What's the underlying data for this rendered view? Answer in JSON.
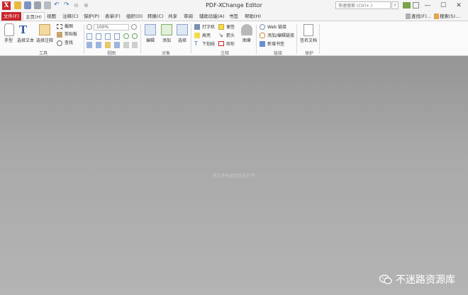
{
  "window": {
    "title": "PDF-XChange Editor",
    "logo_letter": "X"
  },
  "titlebar": {
    "search_placeholder": "快速搜索 (Ctrl+.)",
    "search_button": "›",
    "minimize": "—",
    "maximize": "☐",
    "close": "✕"
  },
  "menu": {
    "file": "文件(F)",
    "tabs": [
      "主页(H)",
      "视图",
      "注释(C)",
      "保护(P)",
      "表单(F)",
      "组织(O)",
      "转换(C)",
      "共享",
      "审阅",
      "辅助功能(A)",
      "书签",
      "帮助(H)"
    ],
    "find": "查找(F)...",
    "search": "搜索(S)..."
  },
  "ribbon": {
    "groups": [
      "工具",
      "视图",
      "对象",
      "注释",
      "链接",
      "保护"
    ],
    "tools": {
      "hand": "手型",
      "select_text": "选择文本",
      "select_annot": "选择注释",
      "snapshot": "截图",
      "clipboard": "剪贴板",
      "find": "查找"
    },
    "view": {
      "zoom": "100%"
    },
    "objects": {
      "edit": "编辑",
      "add": "添加",
      "select": "选择"
    },
    "comments": {
      "typewriter": "打字机",
      "highlight": "高亮",
      "underline": "下划线",
      "sticky_note": "便签",
      "arrow": "箭头",
      "rectangle": "矩形",
      "stamp": "图章"
    },
    "links": {
      "web_links": "Web 链接",
      "add_edit_link": "添加/编辑链接",
      "new_bookmark": "新增书签"
    },
    "protect": {
      "sign_document": "签名文档"
    }
  },
  "workspace": {
    "hint": "将文件拖放到此处打开"
  },
  "watermark": {
    "text": "不迷路资源库"
  },
  "colors": {
    "brand_red": "#c8262a",
    "workspace_gray": "#a3a3a3",
    "ribbon_bg": "#fafafa"
  }
}
